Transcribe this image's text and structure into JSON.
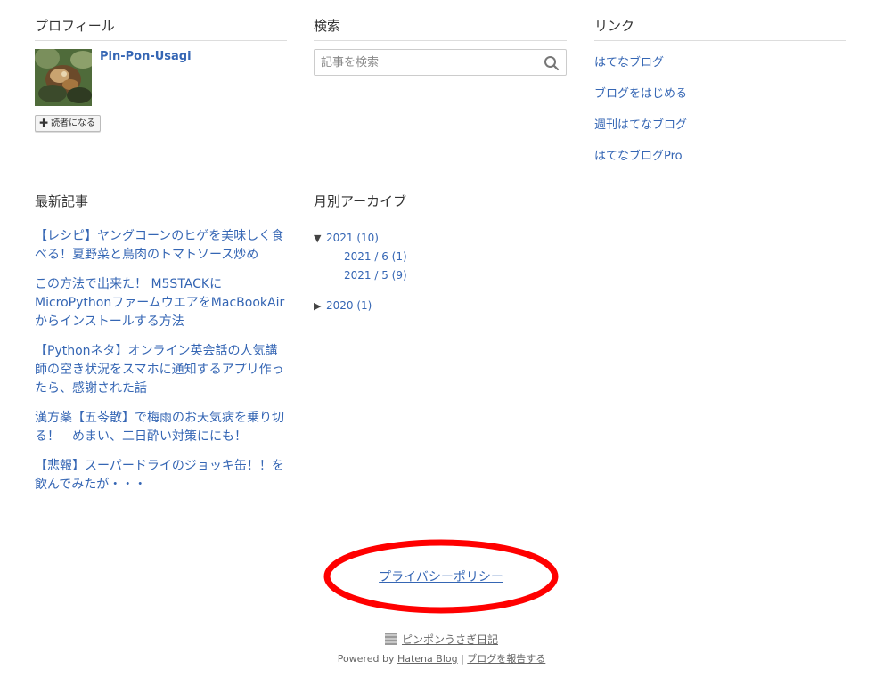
{
  "profile": {
    "title": "プロフィール",
    "name": "Pin-Pon-Usagi",
    "follow_label": "読者になる"
  },
  "search": {
    "title": "検索",
    "placeholder": "記事を検索"
  },
  "links": {
    "title": "リンク",
    "items": [
      "はてなブログ",
      "ブログをはじめる",
      "週刊はてなブログ",
      "はてなブログPro"
    ]
  },
  "recent": {
    "title": "最新記事",
    "items": [
      "【レシピ】ヤングコーンのヒゲを美味しく食べる！夏野菜と鳥肉のトマトソース炒め",
      "この方法で出来た！ M5STACKにMicroPythonファームウエアをMacBookAirからインストールする方法",
      "【Pythonネタ】オンライン英会話の人気講師の空き状況をスマホに通知するアプリ作ったら、感謝された話",
      "漢方薬【五苓散】で梅雨のお天気病を乗り切る！　めまい、二日酔い対策ににも！",
      "【悲報】スーパードライのジョッキ缶！！を飲んでみたが・・・"
    ]
  },
  "archive": {
    "title": "月別アーカイブ",
    "years": [
      {
        "label": "2021 (10)",
        "expanded": true,
        "months": [
          "2021 / 6 (1)",
          "2021 / 5 (9)"
        ]
      },
      {
        "label": "2020 (1)",
        "expanded": false,
        "months": []
      }
    ]
  },
  "footer": {
    "privacy": "プライバシーポリシー",
    "blog_name": "ピンポンうさぎ日記",
    "powered_by": "Powered by ",
    "hatena_blog": "Hatena Blog",
    "separator": " | ",
    "report": "ブログを報告する"
  },
  "colors": {
    "link": "#3566b4",
    "annotation": "#ff0000"
  }
}
